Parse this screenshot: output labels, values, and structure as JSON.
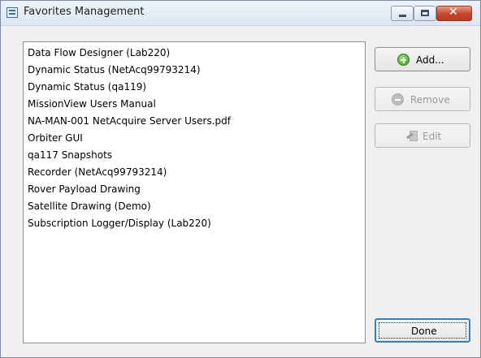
{
  "window": {
    "title": "Favorites Management"
  },
  "favorites": {
    "items": [
      "Data Flow Designer (Lab220)",
      "Dynamic Status (NetAcq99793214)",
      "Dynamic Status (qa119)",
      "MissionView Users Manual",
      "NA-MAN-001 NetAcquire Server Users.pdf",
      "Orbiter GUI",
      "qa117 Snapshots",
      "Recorder (NetAcq99793214)",
      "Rover Payload Drawing",
      "Satellite Drawing (Demo)",
      "Subscription Logger/Display (Lab220)"
    ]
  },
  "buttons": {
    "add": "Add...",
    "remove": "Remove",
    "edit": "Edit",
    "done": "Done"
  },
  "icons": {
    "app": "favorites-window-icon",
    "add": "green-plus-circle-icon",
    "remove": "gray-minus-circle-icon",
    "edit": "edit-page-icon"
  }
}
